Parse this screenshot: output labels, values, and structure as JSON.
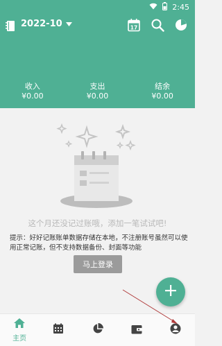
{
  "status_bar": {
    "time": "2:45"
  },
  "header": {
    "month": "2022-10",
    "calendar_day": "17"
  },
  "summary": [
    {
      "label": "收入",
      "value": "¥0.00"
    },
    {
      "label": "支出",
      "value": "¥0.00"
    },
    {
      "label": "结余",
      "value": "¥0.00"
    }
  ],
  "empty_state": {
    "message": "这个月还没记过账哦，添加一笔试试吧!"
  },
  "tip": {
    "text": "提示：好好记账账单数据存储在本地，不注册账号虽然可以使用正常记账，但不支持数据备份、封面等功能"
  },
  "login_button": {
    "label": "马上登录"
  },
  "bottom_nav": {
    "home_label": "主页"
  },
  "colors": {
    "accent": "#4fb094",
    "button_gray": "#9b9b9b",
    "muted_text": "#b9b9b9"
  }
}
